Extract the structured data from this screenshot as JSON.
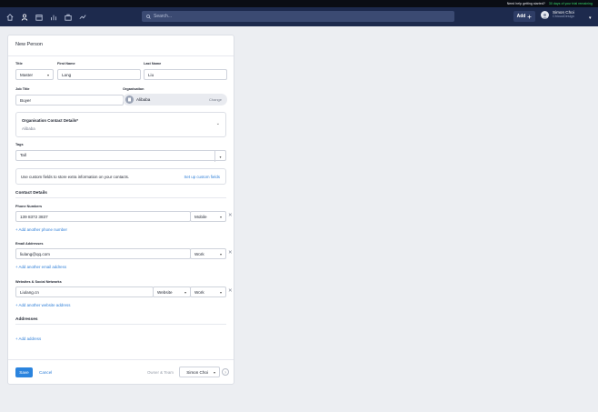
{
  "topstrip": {
    "help_text": "Need help getting started?",
    "trial_text": "30 days of your trial remaining"
  },
  "nav": {
    "icons": [
      "home-icon",
      "person-icon",
      "calendar-icon",
      "chart-icon",
      "briefcase-icon",
      "trend-icon"
    ],
    "search_placeholder": "Search...",
    "add_label": "Add",
    "user_name": "Simon Choi",
    "user_company": "ChiouoDesign"
  },
  "form": {
    "title": "New Person",
    "title_label": "Title",
    "title_value": "Master",
    "first_name_label": "First Name",
    "first_name_value": "Lang",
    "last_name_label": "Last Name",
    "last_name_value": "Liu",
    "job_title_label": "Job Title",
    "job_title_value": "Buyer",
    "organisation_label": "Organisation",
    "organisation_value": "Alibaba",
    "organisation_change": "Change",
    "org_contact_title": "Organisation Contact Details*",
    "org_contact_sub": "Alibaba",
    "tags_label": "Tags",
    "tag_value": "Tall",
    "custom_fields_text": "Use custom fields to store extra information on your contacts.",
    "custom_fields_link": "Set up custom fields",
    "contact_details_heading": "Contact Details",
    "phone_label": "Phone Numbers",
    "phone_value": "139 8372 3837",
    "phone_type": "Mobile",
    "add_phone": "+ Add another phone number",
    "email_label": "Email Addresses",
    "email_value": "liulang@qq.com",
    "email_type": "Work",
    "add_email": "+ Add another email address",
    "web_label": "Websites & Social Networks",
    "web_value": "Liulang.cn",
    "web_kind": "Website",
    "web_type": "Work",
    "add_web": "+ Add another website address",
    "addresses_heading": "Addresses",
    "add_address": "+ Add address",
    "save_label": "Save",
    "cancel_label": "Cancel",
    "owner_label": "Owner & Team",
    "owner_value": "Simon Choi",
    "help_glyph": "?"
  },
  "colors": {
    "nav_bg": "#1d2a4d",
    "accent": "#2b84de",
    "trial_green": "#38d66b"
  }
}
